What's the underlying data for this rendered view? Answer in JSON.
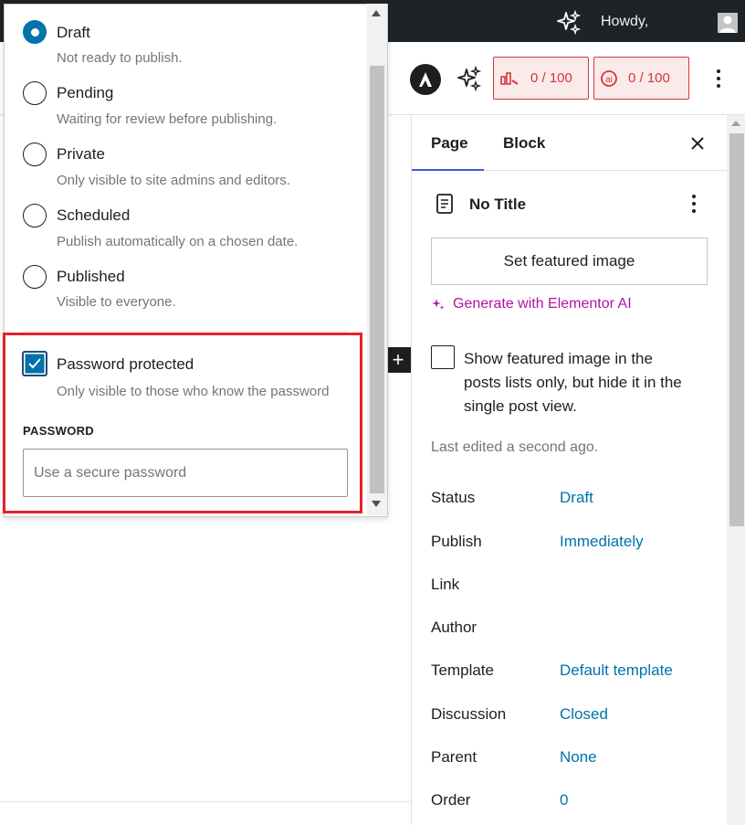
{
  "admin_bar": {
    "greeting": "Howdy,"
  },
  "toolbar": {
    "seo_score": "0 / 100",
    "readability_score": "0 / 100"
  },
  "status_popover": {
    "options": [
      {
        "label": "Draft",
        "description": "Not ready to publish.",
        "selected": true
      },
      {
        "label": "Pending",
        "description": "Waiting for review before publishing.",
        "selected": false
      },
      {
        "label": "Private",
        "description": "Only visible to site admins and editors.",
        "selected": false
      },
      {
        "label": "Scheduled",
        "description": "Publish automatically on a chosen date.",
        "selected": false
      },
      {
        "label": "Published",
        "description": "Visible to everyone.",
        "selected": false
      }
    ],
    "password_protected": {
      "label": "Password protected",
      "description": "Only visible to those who know the password",
      "checked": true
    },
    "password_field": {
      "label": "PASSWORD",
      "placeholder": "Use a secure password",
      "value": ""
    }
  },
  "add_block_glyph": "+",
  "sidebar": {
    "tabs": [
      {
        "label": "Page",
        "active": true
      },
      {
        "label": "Block",
        "active": false
      }
    ],
    "document_title": "No Title",
    "featured_image_button": "Set featured image",
    "generate_ai_link": "Generate with Elementor AI",
    "featured_checkbox_label": "Show featured image in the posts lists only, but hide it in the single post view.",
    "last_edited": "Last edited a second ago.",
    "rows": [
      {
        "label": "Status",
        "value": "Draft"
      },
      {
        "label": "Publish",
        "value": "Immediately"
      },
      {
        "label": "Link",
        "value": ""
      },
      {
        "label": "Author",
        "value": ""
      },
      {
        "label": "Template",
        "value": "Default template"
      },
      {
        "label": "Discussion",
        "value": "Closed"
      },
      {
        "label": "Parent",
        "value": "None"
      },
      {
        "label": "Order",
        "value": "0"
      }
    ]
  },
  "colors": {
    "accent": "#3858e9",
    "link": "#0073aa",
    "highlight_box": "#e3222c",
    "ai_magenta": "#b113a5",
    "score_red": "#d63638"
  }
}
